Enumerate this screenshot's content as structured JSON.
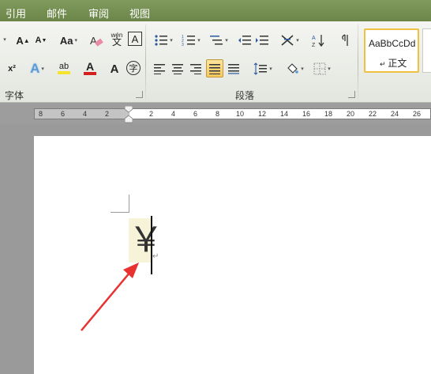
{
  "tabs": [
    "引用",
    "邮件",
    "审阅",
    "视图"
  ],
  "ribbon": {
    "font_group_label": "字体",
    "paragraph_group_label": "段落",
    "font_size_grow": "A",
    "font_size_shrink": "A",
    "change_case": "Aa",
    "clear_format": "A",
    "superscript": "x²",
    "text_effect": "A",
    "highlight": "ab",
    "font_color": "A",
    "char_shading": "A",
    "enclose_char": "字",
    "phonetic": "wén",
    "char_border": "A",
    "style_sample": "AaBbCcDd",
    "style_name": "正文",
    "highlight_color": "#f5e42a",
    "font_color_value": "#d42020"
  },
  "ruler": {
    "numbers": [
      "8",
      "6",
      "4",
      "2",
      "2",
      "4",
      "6",
      "8",
      "10",
      "12",
      "14",
      "16",
      "18",
      "20",
      "22",
      "24",
      "26"
    ]
  },
  "document": {
    "content": "￥"
  }
}
